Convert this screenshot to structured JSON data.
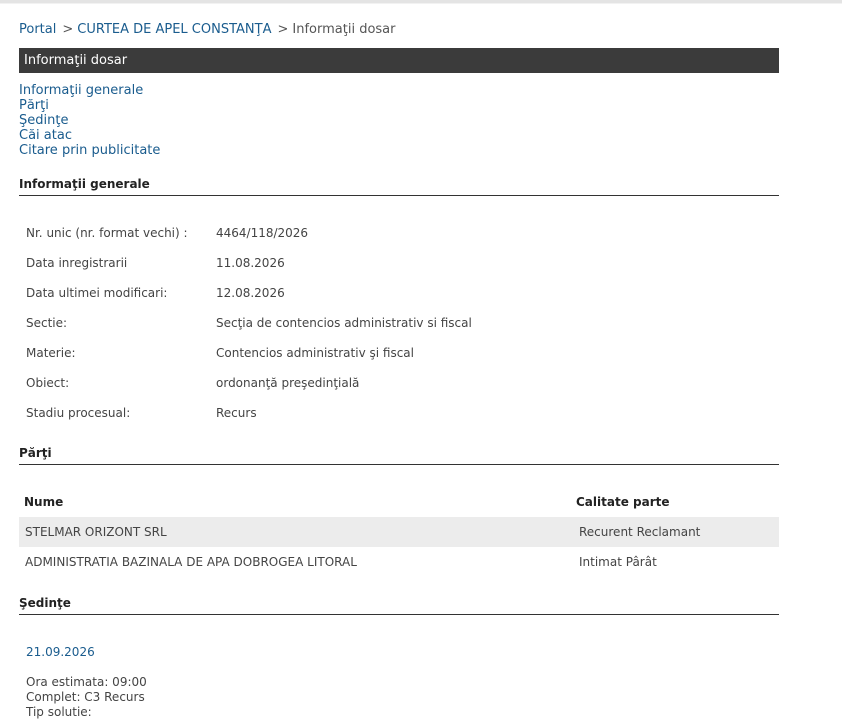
{
  "breadcrumb": {
    "portal": "Portal",
    "sep": ">",
    "court": "CURTEA DE APEL CONSTANŢA",
    "current": "Informaţii dosar"
  },
  "banner": {
    "title": "Informaţii dosar"
  },
  "nav": {
    "links": [
      "Informaţii generale",
      "Părţi",
      "Şedinţe",
      "Căi atac",
      "Citare prin publicitate"
    ]
  },
  "general": {
    "heading": "Informaţii generale",
    "fields": [
      {
        "label": "Nr. unic (nr. format vechi) :",
        "value": "4464/118/2026"
      },
      {
        "label": "Data inregistrarii",
        "value": "11.08.2026"
      },
      {
        "label": "Data ultimei modificari:",
        "value": "12.08.2026"
      },
      {
        "label": "Sectie:",
        "value": "Secţia de contencios administrativ si fiscal"
      },
      {
        "label": "Materie:",
        "value": "Contencios administrativ şi fiscal"
      },
      {
        "label": "Obiect:",
        "value": "ordonanţă preşedinţială"
      },
      {
        "label": "Stadiu procesual:",
        "value": "Recurs"
      }
    ]
  },
  "parties": {
    "heading": "Părţi",
    "col_name": "Nume",
    "col_role": "Calitate parte",
    "rows": [
      {
        "name": "STELMAR ORIZONT SRL",
        "role": "Recurent Reclamant"
      },
      {
        "name": "ADMINISTRATIA BAZINALA DE APA DOBROGEA LITORAL",
        "role": "Intimat Pârât"
      }
    ]
  },
  "hearings": {
    "heading": "Şedinţe",
    "date": "21.09.2026",
    "lines": [
      "Ora estimata: 09:00",
      "Complet: C3 Recurs",
      "Tip solutie:"
    ]
  }
}
